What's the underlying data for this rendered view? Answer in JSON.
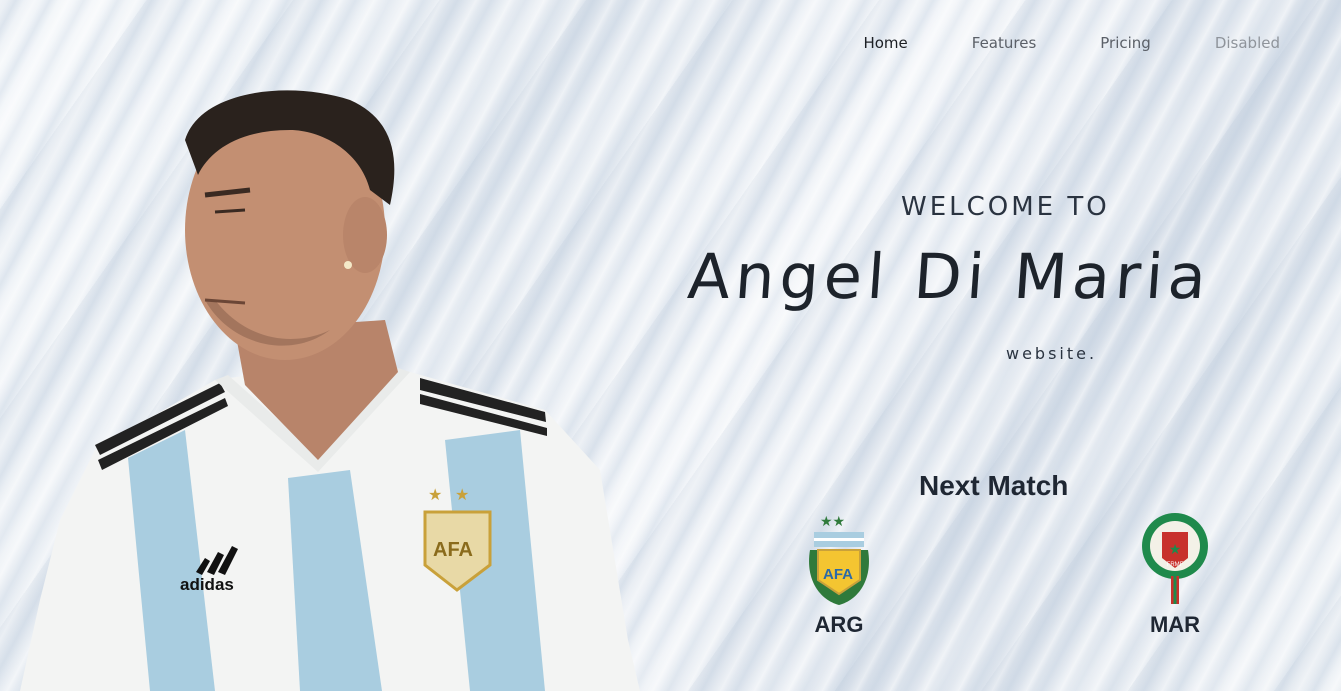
{
  "nav": {
    "items": [
      {
        "label": "Home",
        "state": "active"
      },
      {
        "label": "Features",
        "state": "normal"
      },
      {
        "label": "Pricing",
        "state": "normal"
      },
      {
        "label": "Disabled",
        "state": "disabled"
      }
    ]
  },
  "hero": {
    "welcome": "WELCOME TO",
    "name": "Angel Di Maria",
    "subtitle": "website."
  },
  "match": {
    "heading": "Next Match",
    "home": {
      "code": "ARG",
      "crest_text": "AFA"
    },
    "away": {
      "code": "MAR",
      "crest_text": "FRMF"
    }
  },
  "jersey": {
    "brand": "adidas",
    "crest_text": "AFA"
  },
  "colors": {
    "argentina_sky": "#a9cde0",
    "gold": "#c9a13a",
    "morocco_red": "#c8312c",
    "morocco_green": "#1f8a4c"
  }
}
